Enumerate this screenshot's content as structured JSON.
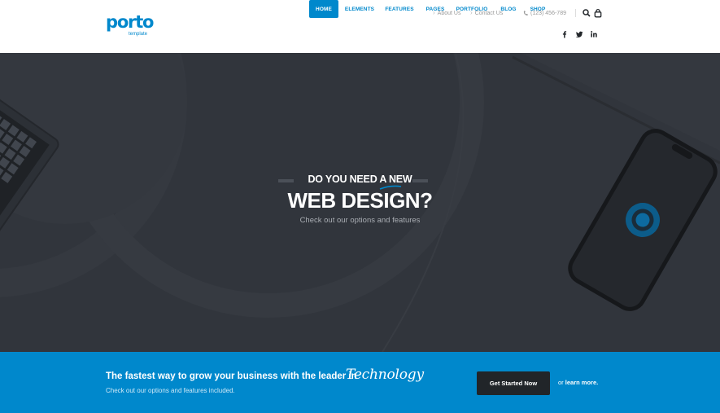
{
  "header": {
    "logo": {
      "word": "porto",
      "sub": "template"
    },
    "topbar": {
      "about_label": "About Us",
      "contact_label": "Contact Us",
      "phone": "(123) 456-789"
    },
    "nav": {
      "items": [
        {
          "label": "HOME",
          "active": true
        },
        {
          "label": "ELEMENTS"
        },
        {
          "label": "FEATURES"
        },
        {
          "label": "PAGES"
        },
        {
          "label": "PORTFOLIO"
        },
        {
          "label": "BLOG"
        },
        {
          "label": "SHOP"
        }
      ]
    },
    "social": [
      "facebook-icon",
      "twitter-icon",
      "linkedin-icon"
    ]
  },
  "hero": {
    "eyebrow": "DO YOU NEED A NEW",
    "headline": "WEB DESIGN?",
    "subtitle": "Check out our options and features"
  },
  "cta": {
    "title": "The fastest way to grow your business with the leader in",
    "script_word": "Technology",
    "subtitle": "Check out our options and features included.",
    "button_label": "Get Started Now",
    "or_text": "or",
    "learn_more": "learn more."
  },
  "colors": {
    "brand": "#0088cc",
    "hero_bg": "#31353c",
    "button_dark": "#212529"
  }
}
